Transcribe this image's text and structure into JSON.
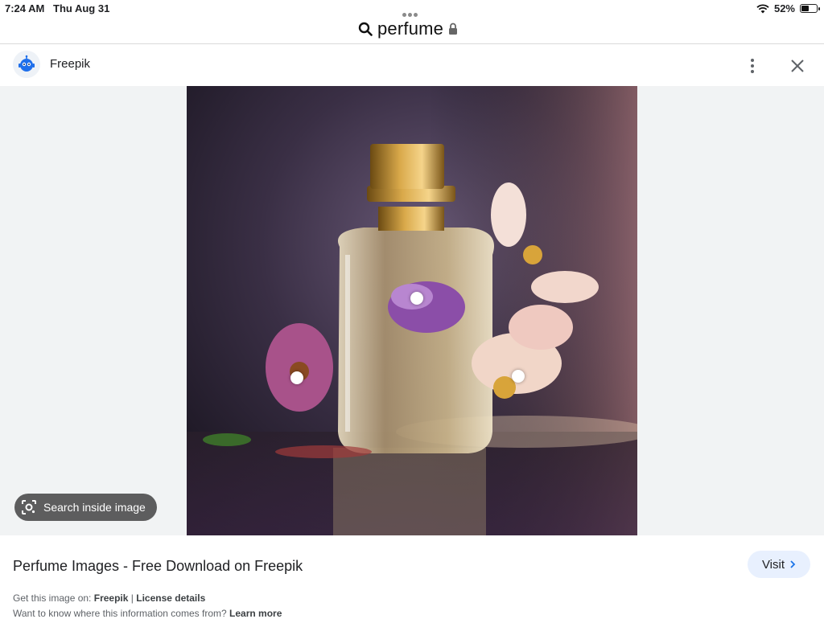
{
  "status_bar": {
    "time": "7:24 AM",
    "date": "Thu Aug 31",
    "battery": "52%",
    "battery_level": 0.52,
    "icons": [
      "wifi-icon",
      "battery-icon"
    ]
  },
  "search": {
    "query": "perfume",
    "icons": [
      "search-icon",
      "lock-icon"
    ]
  },
  "source": {
    "name": "Freepik",
    "icons": [
      "freepik-logo-icon",
      "more-vert-icon",
      "close-icon"
    ]
  },
  "image": {
    "description_icon": "perfume-bottle-with-flowers-image",
    "lens_button": {
      "label": "Search inside image",
      "icon": "lens-icon"
    }
  },
  "result": {
    "title": "Perfume Images - Free Download on Freepik",
    "visit_label": "Visit",
    "get_prefix": "Get this image on:",
    "get_source": "Freepik",
    "separator": "|",
    "license": "License details",
    "where_question": "Want to know where this information comes from?",
    "learn_more": "Learn more"
  },
  "colors": {
    "visit_bg": "#e8f0fe",
    "image_area_bg": "#f1f3f4",
    "lens_bg": "#505050"
  }
}
